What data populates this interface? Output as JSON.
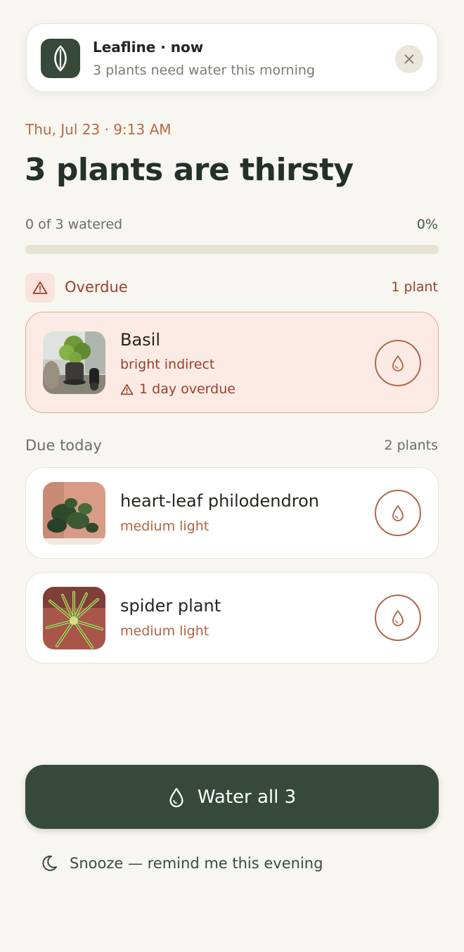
{
  "notification": {
    "title": "Leafline · now",
    "body": "3 plants need water this morning",
    "icon": "leaf-icon",
    "close_icon": "close-icon"
  },
  "header": {
    "timestamp": "Thu, Jul 23 · 9:13 AM",
    "headline": "3 plants are thirsty"
  },
  "progress": {
    "label": "0 of 3 watered",
    "percent_label": "0%",
    "fraction": 0
  },
  "overdue": {
    "title": "Overdue",
    "count": "1 plant",
    "icon": "warning-icon",
    "plants": [
      {
        "name": "Basil",
        "light": "bright indirect",
        "note": "1 day overdue"
      }
    ]
  },
  "due_today": {
    "title": "Due today",
    "count": "2 plants",
    "plants": [
      {
        "name": "heart-leaf philodendron",
        "light": "medium light"
      },
      {
        "name": "spider plant",
        "light": "medium light"
      }
    ]
  },
  "actions": {
    "water_all": "Water all 3",
    "snooze": "Snooze — remind me this evening"
  },
  "colors": {
    "accent_green": "#36493b",
    "terracotta": "#b4674a",
    "overdue_red": "#9a3f28",
    "background": "#f8f6f1"
  }
}
